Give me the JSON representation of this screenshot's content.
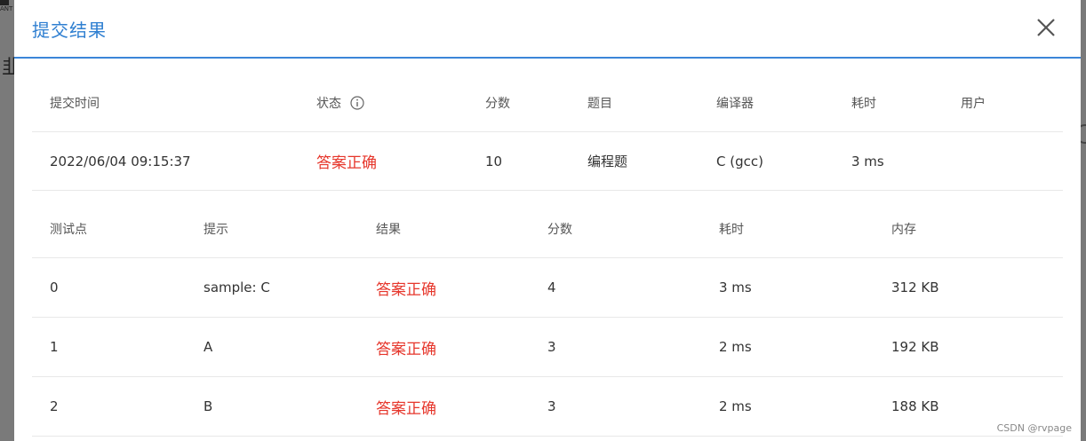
{
  "background": {
    "logo_text": "ANT",
    "partial_char": "韭"
  },
  "modal": {
    "title": "提交结果"
  },
  "submission": {
    "headers": {
      "time": "提交时间",
      "status": "状态",
      "score": "分数",
      "problem": "题目",
      "compiler": "编译器",
      "duration": "耗时",
      "user": "用户"
    },
    "row": {
      "time": "2022/06/04 09:15:37",
      "status": "答案正确",
      "score": "10",
      "problem": "编程题",
      "compiler": "C (gcc)",
      "duration": "3 ms",
      "user": ""
    }
  },
  "testcases": {
    "headers": {
      "id": "测试点",
      "hint": "提示",
      "result": "结果",
      "score": "分数",
      "duration": "耗时",
      "memory": "内存"
    },
    "rows": [
      {
        "id": "0",
        "hint": "sample: C",
        "result": "答案正确",
        "score": "4",
        "duration": "3 ms",
        "memory": "312 KB"
      },
      {
        "id": "1",
        "hint": "A",
        "result": "答案正确",
        "score": "3",
        "duration": "2 ms",
        "memory": "192 KB"
      },
      {
        "id": "2",
        "hint": "B",
        "result": "答案正确",
        "score": "3",
        "duration": "2 ms",
        "memory": "188 KB"
      }
    ]
  },
  "watermark": "CSDN @rvpage",
  "colors": {
    "accent": "#2f7fd1",
    "success_text": "#e6362b"
  }
}
